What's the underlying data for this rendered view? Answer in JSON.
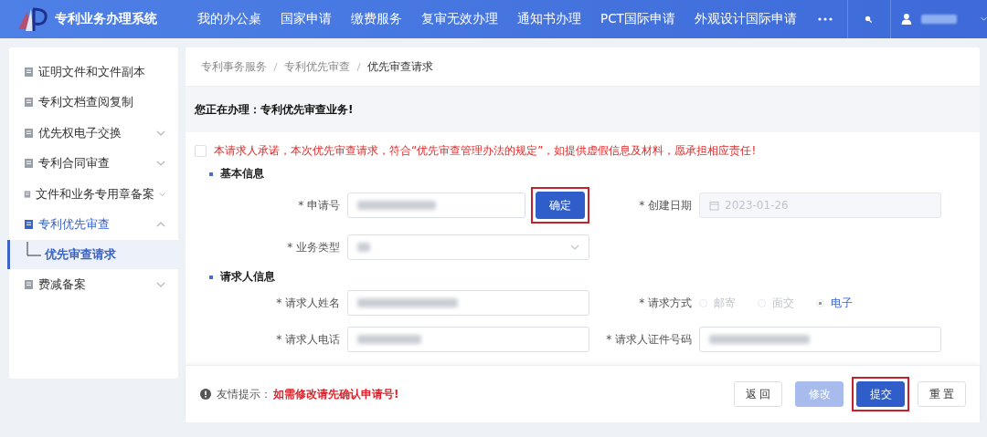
{
  "header": {
    "title": "专利业务办理系统",
    "nav": [
      {
        "label": "我的办公桌",
        "selected": false
      },
      {
        "label": "国家申请",
        "selected": false
      },
      {
        "label": "缴费服务",
        "selected": false
      },
      {
        "label": "复审无效办理",
        "selected": false
      },
      {
        "label": "通知书办理",
        "selected": false
      },
      {
        "label": "PCT国际申请",
        "selected": false
      },
      {
        "label": "外观设计国际申请",
        "selected": false
      }
    ]
  },
  "sidebar": {
    "items": [
      {
        "label": "证明文件和文件副本",
        "kind": "link",
        "selected": false
      },
      {
        "label": "专利文档查阅复制",
        "kind": "link",
        "selected": false
      },
      {
        "label": "优先权电子交换",
        "kind": "group",
        "expanded": false,
        "selected": false
      },
      {
        "label": "专利合同审查",
        "kind": "group",
        "expanded": false,
        "selected": false
      },
      {
        "label": "文件和业务专用章备案",
        "kind": "group",
        "expanded": false,
        "selected": false
      },
      {
        "label": "专利优先审查",
        "kind": "group",
        "expanded": true,
        "selected": true,
        "children": [
          {
            "label": "优先审查请求",
            "selected": true
          }
        ]
      },
      {
        "label": "费减备案",
        "kind": "group",
        "expanded": false,
        "selected": false
      }
    ]
  },
  "breadcrumb": [
    "专利事务服务",
    "专利优先审查",
    "优先审查请求"
  ],
  "notice": "您正在办理：专利优先审查业务!",
  "pledge": {
    "text": "本请求人承诺，本次优先审查请求，符合“优先审查管理办法的规定”，如提供虚假信息及材料，愿承担相应责任!",
    "checked": false
  },
  "basic_info": {
    "title": "基本信息",
    "application_no": {
      "label": "* 申请号"
    },
    "confirm_button": {
      "label": "确定",
      "highlighted": true
    },
    "created_date": {
      "label": "* 创建日期",
      "value": "2023-01-26",
      "disabled": true
    },
    "business_type": {
      "label": "* 业务类型"
    }
  },
  "applicant_info": {
    "title": "请求人信息",
    "name": {
      "label": "* 请求人姓名"
    },
    "method": {
      "label": "* 请求方式",
      "options": [
        {
          "label": "邮寄",
          "selected": false
        },
        {
          "label": "面交",
          "selected": false
        },
        {
          "label": "电子",
          "selected": true
        }
      ]
    },
    "phone": {
      "label": "* 请求人电话"
    },
    "id_no": {
      "label": "* 请求人证件号码"
    }
  },
  "footer": {
    "tip_label": "友情提示：",
    "tip_text": "如需修改请先确认申请号!",
    "buttons": [
      {
        "label": "返 回",
        "kind": "default",
        "disabled": false,
        "highlighted": false
      },
      {
        "label": "修改",
        "kind": "primary",
        "disabled": true,
        "highlighted": false
      },
      {
        "label": "提交",
        "kind": "primary",
        "disabled": false,
        "highlighted": true
      },
      {
        "label": "重 置",
        "kind": "default",
        "disabled": false,
        "highlighted": false
      }
    ]
  }
}
